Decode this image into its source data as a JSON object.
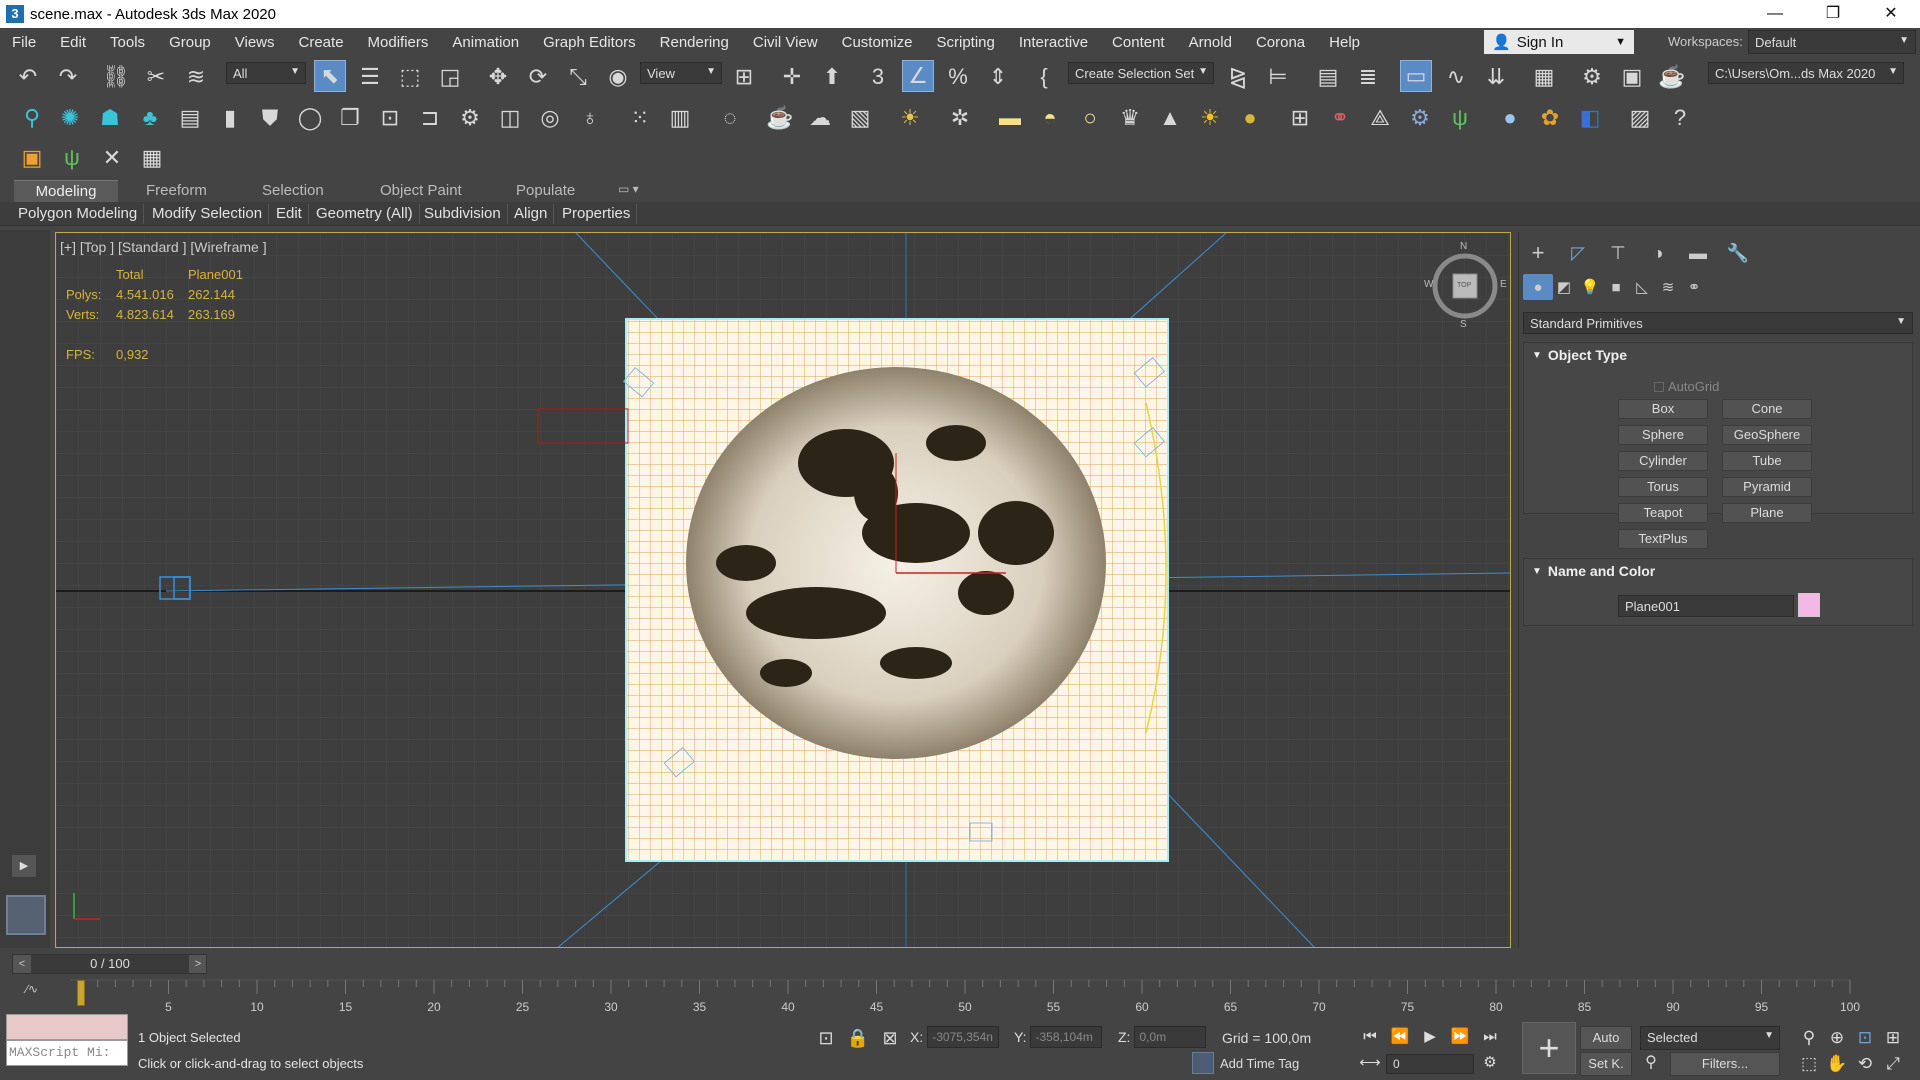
{
  "window": {
    "title": "scene.max - Autodesk 3ds Max 2020",
    "app_icon": "3",
    "controls": [
      "—",
      "❐",
      "✕"
    ]
  },
  "menu": [
    "File",
    "Edit",
    "Tools",
    "Group",
    "Views",
    "Create",
    "Modifiers",
    "Animation",
    "Graph Editors",
    "Rendering",
    "Civil View",
    "Customize",
    "Scripting",
    "Interactive",
    "Content",
    "Arnold",
    "Corona",
    "Help"
  ],
  "account": {
    "sign_in": "Sign In",
    "workspaces_label": "Workspaces:",
    "workspace": "Default"
  },
  "toolbar": {
    "filter": "All",
    "coord_system": "View",
    "selection_set": "Create Selection Set",
    "project_path": "C:\\Users\\Om...ds Max 2020"
  },
  "ribbon": {
    "tabs": [
      "Modeling",
      "Freeform",
      "Selection",
      "Object Paint",
      "Populate"
    ],
    "active_tab": "Modeling",
    "sub": [
      "Polygon Modeling",
      "Modify Selection",
      "Edit",
      "Geometry (All)",
      "Subdivision",
      "Align",
      "Properties"
    ]
  },
  "viewport": {
    "label": "[+] [Top ] [Standard ] [Wireframe ]",
    "stats": {
      "col_total": "Total",
      "col_object": "Plane001",
      "polys_label": "Polys:",
      "polys_total": "4.541.016",
      "polys_object": "262.144",
      "verts_label": "Verts:",
      "verts_total": "4.823.614",
      "verts_object": "263.169",
      "fps_label": "FPS:",
      "fps_value": "0,932"
    },
    "viewcube": {
      "n": "N",
      "s": "S",
      "w": "W",
      "e": "E",
      "face": "TOP"
    }
  },
  "command_panel": {
    "category": "Standard Primitives",
    "object_type": {
      "title": "Object Type",
      "autogrid": "AutoGrid",
      "buttons": [
        "Box",
        "Cone",
        "Sphere",
        "GeoSphere",
        "Cylinder",
        "Tube",
        "Torus",
        "Pyramid",
        "Teapot",
        "Plane",
        "TextPlus"
      ]
    },
    "name_and_color": {
      "title": "Name and Color",
      "name": "Plane001",
      "color": "#f5b8e6"
    }
  },
  "timeline": {
    "position": "0 / 100",
    "ticks": [
      "5",
      "10",
      "15",
      "20",
      "25",
      "30",
      "35",
      "40",
      "45",
      "50",
      "55",
      "60",
      "65",
      "70",
      "75",
      "80",
      "85",
      "90",
      "95",
      "100"
    ]
  },
  "status": {
    "maxscript": "MAXScript Mi:",
    "selected_count": "1 Object Selected",
    "prompt": "Click or click-and-drag to select objects",
    "x_label": "X:",
    "x_value": "-3075,354n",
    "y_label": "Y:",
    "y_value": "-358,104m",
    "z_label": "Z:",
    "z_value": "0,0m",
    "grid": "Grid = 100,0m",
    "add_time_tag": "Add Time Tag",
    "frame": "0",
    "auto_key": "Auto",
    "set_key": "Set K.",
    "key_filter": "Selected",
    "filters": "Filters..."
  }
}
